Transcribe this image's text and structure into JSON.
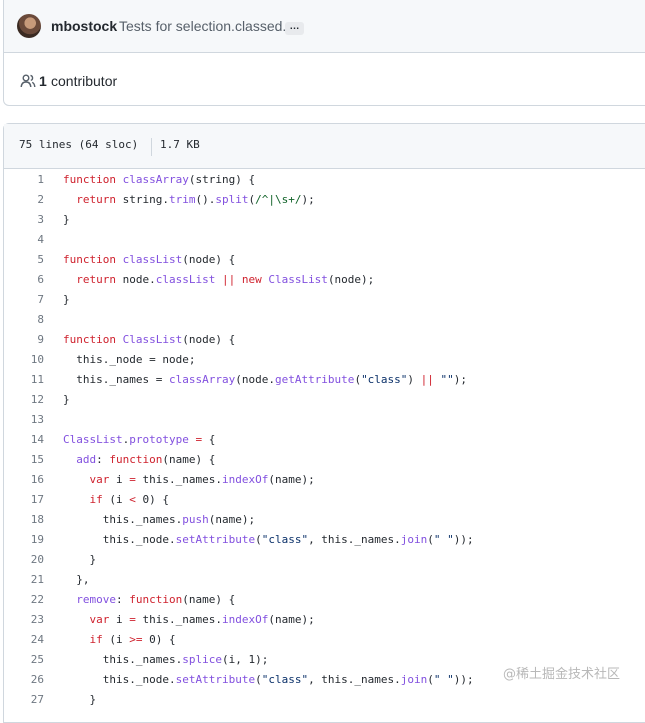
{
  "commit": {
    "author": "mbostock",
    "message": "Tests for selection.classed.",
    "ellipsis": "…"
  },
  "contributors": {
    "count": "1",
    "label": "contributor"
  },
  "file": {
    "lines_info": "75 lines (64 sloc)",
    "size": "1.7 KB"
  },
  "code_lines": [
    {
      "n": "1",
      "tokens": [
        [
          "kw",
          "function "
        ],
        [
          "fn",
          "classArray"
        ],
        [
          "",
          "(string) {"
        ]
      ]
    },
    {
      "n": "2",
      "tokens": [
        [
          "",
          "  "
        ],
        [
          "kw",
          "return "
        ],
        [
          "",
          "string."
        ],
        [
          "fn",
          "trim"
        ],
        [
          "",
          "()."
        ],
        [
          "fn",
          "split"
        ],
        [
          "",
          "("
        ],
        [
          "rx",
          "/^|\\s+/"
        ],
        [
          "",
          ");"
        ]
      ]
    },
    {
      "n": "3",
      "tokens": [
        [
          "",
          "}"
        ]
      ]
    },
    {
      "n": "4",
      "tokens": []
    },
    {
      "n": "5",
      "tokens": [
        [
          "kw",
          "function "
        ],
        [
          "fn",
          "classList"
        ],
        [
          "",
          "(node) {"
        ]
      ]
    },
    {
      "n": "6",
      "tokens": [
        [
          "",
          "  "
        ],
        [
          "kw",
          "return "
        ],
        [
          "",
          "node."
        ],
        [
          "fn",
          "classList"
        ],
        [
          "",
          ""
        ],
        [
          "kw",
          " || new "
        ],
        [
          "fn",
          "ClassList"
        ],
        [
          "",
          "(node);"
        ]
      ]
    },
    {
      "n": "7",
      "tokens": [
        [
          "",
          "}"
        ]
      ]
    },
    {
      "n": "8",
      "tokens": []
    },
    {
      "n": "9",
      "tokens": [
        [
          "kw",
          "function "
        ],
        [
          "fn",
          "ClassList"
        ],
        [
          "",
          "(node) {"
        ]
      ]
    },
    {
      "n": "10",
      "tokens": [
        [
          "",
          "  this._node = node;"
        ]
      ]
    },
    {
      "n": "11",
      "tokens": [
        [
          "",
          "  this._names = "
        ],
        [
          "fn",
          "classArray"
        ],
        [
          "",
          "(node."
        ],
        [
          "fn",
          "getAttribute"
        ],
        [
          "",
          "("
        ],
        [
          "str",
          "\"class\""
        ],
        [
          "",
          ") "
        ],
        [
          "kw",
          "||"
        ],
        [
          "str",
          " \"\""
        ],
        [
          "",
          ");"
        ]
      ]
    },
    {
      "n": "12",
      "tokens": [
        [
          "",
          "}"
        ]
      ]
    },
    {
      "n": "13",
      "tokens": []
    },
    {
      "n": "14",
      "tokens": [
        [
          "fn",
          "ClassList"
        ],
        [
          "",
          "."
        ],
        [
          "fn",
          "prototype"
        ],
        [
          "kw",
          " = "
        ],
        [
          "",
          "{"
        ]
      ]
    },
    {
      "n": "15",
      "tokens": [
        [
          "",
          "  "
        ],
        [
          "fn",
          "add"
        ],
        [
          "",
          ": "
        ],
        [
          "kw",
          "function"
        ],
        [
          "",
          "(name) {"
        ]
      ]
    },
    {
      "n": "16",
      "tokens": [
        [
          "",
          "    "
        ],
        [
          "kw",
          "var "
        ],
        [
          "",
          "i "
        ],
        [
          "kw",
          "= "
        ],
        [
          "",
          "this._names."
        ],
        [
          "fn",
          "indexOf"
        ],
        [
          "",
          "(name);"
        ]
      ]
    },
    {
      "n": "17",
      "tokens": [
        [
          "",
          "    "
        ],
        [
          "kw",
          "if "
        ],
        [
          "",
          "(i "
        ],
        [
          "kw",
          "< "
        ],
        [
          "",
          "0) {"
        ]
      ]
    },
    {
      "n": "18",
      "tokens": [
        [
          "",
          "      this._names."
        ],
        [
          "fn",
          "push"
        ],
        [
          "",
          "(name);"
        ]
      ]
    },
    {
      "n": "19",
      "tokens": [
        [
          "",
          "      this._node."
        ],
        [
          "fn",
          "setAttribute"
        ],
        [
          "",
          "("
        ],
        [
          "str",
          "\"class\""
        ],
        [
          "",
          ", this._names."
        ],
        [
          "fn",
          "join"
        ],
        [
          "",
          "("
        ],
        [
          "str",
          "\" \""
        ],
        [
          "",
          "));"
        ]
      ]
    },
    {
      "n": "20",
      "tokens": [
        [
          "",
          "    }"
        ]
      ]
    },
    {
      "n": "21",
      "tokens": [
        [
          "",
          "  },"
        ]
      ]
    },
    {
      "n": "22",
      "tokens": [
        [
          "",
          "  "
        ],
        [
          "fn",
          "remove"
        ],
        [
          "",
          ": "
        ],
        [
          "kw",
          "function"
        ],
        [
          "",
          "(name) {"
        ]
      ]
    },
    {
      "n": "23",
      "tokens": [
        [
          "",
          "    "
        ],
        [
          "kw",
          "var "
        ],
        [
          "",
          "i "
        ],
        [
          "kw",
          "= "
        ],
        [
          "",
          "this._names."
        ],
        [
          "fn",
          "indexOf"
        ],
        [
          "",
          "(name);"
        ]
      ]
    },
    {
      "n": "24",
      "tokens": [
        [
          "",
          "    "
        ],
        [
          "kw",
          "if "
        ],
        [
          "",
          "(i "
        ],
        [
          "kw",
          ">= "
        ],
        [
          "",
          "0) {"
        ]
      ]
    },
    {
      "n": "25",
      "tokens": [
        [
          "",
          "      this._names."
        ],
        [
          "fn",
          "splice"
        ],
        [
          "",
          "(i, 1);"
        ]
      ]
    },
    {
      "n": "26",
      "tokens": [
        [
          "",
          "      this._node."
        ],
        [
          "fn",
          "setAttribute"
        ],
        [
          "",
          "("
        ],
        [
          "str",
          "\"class\""
        ],
        [
          "",
          ", this._names."
        ],
        [
          "fn",
          "join"
        ],
        [
          "",
          "("
        ],
        [
          "str",
          "\" \""
        ],
        [
          "",
          "));"
        ]
      ]
    },
    {
      "n": "27",
      "tokens": [
        [
          "",
          "    }"
        ]
      ]
    }
  ],
  "watermark": "@稀土掘金技术社区"
}
